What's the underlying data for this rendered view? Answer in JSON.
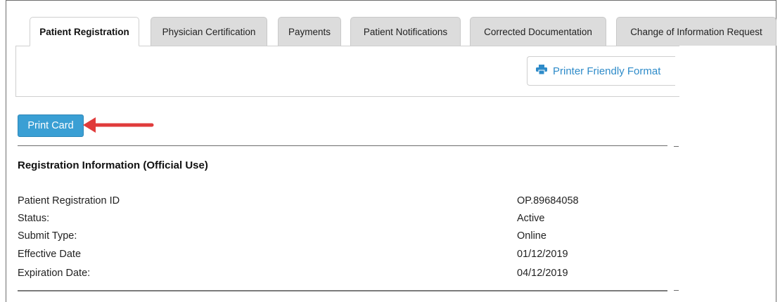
{
  "tabs": [
    {
      "label": "Patient Registration",
      "active": true
    },
    {
      "label": "Physician Certification",
      "active": false
    },
    {
      "label": "Payments",
      "active": false
    },
    {
      "label": "Patient Notifications",
      "active": false
    },
    {
      "label": "Corrected Documentation",
      "active": false
    },
    {
      "label": "Change of Information Request",
      "active": false
    }
  ],
  "toolbar": {
    "printer_friendly_label": "Printer Friendly Format",
    "printer_icon": "printer-icon"
  },
  "actions": {
    "print_card_label": "Print Card"
  },
  "registration": {
    "title": "Registration Information (Official Use)",
    "rows": [
      {
        "label": "Patient Registration ID",
        "value": "OP.89684058"
      },
      {
        "label": "Status:",
        "value": "Active"
      },
      {
        "label": "Submit Type:",
        "value": "Online"
      },
      {
        "label": "Effective Date",
        "value": "01/12/2019"
      },
      {
        "label": "Expiration Date:",
        "value": "04/12/2019"
      }
    ]
  },
  "colors": {
    "accent": "#3a9fd4",
    "link": "#2e8bc9",
    "arrow": "#e03b3b",
    "tab_inactive": "#dcdcdc"
  }
}
